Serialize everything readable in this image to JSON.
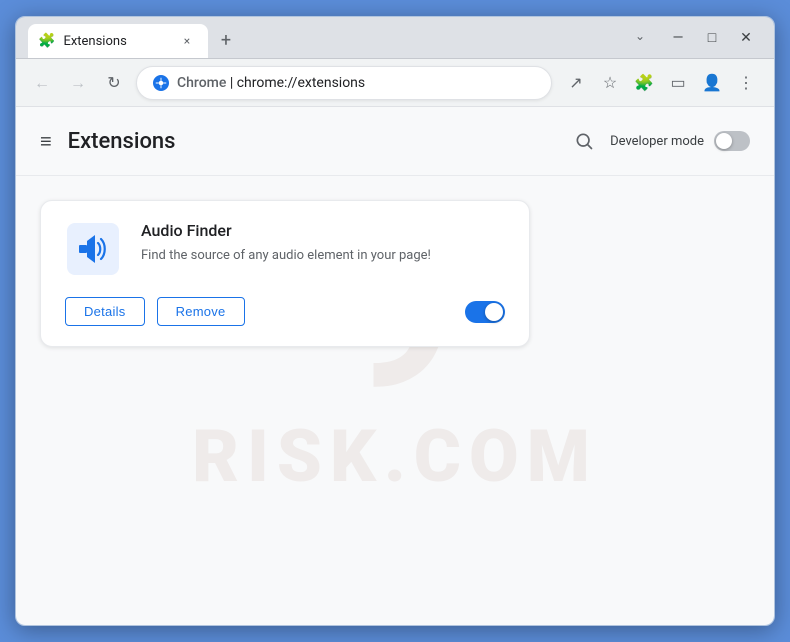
{
  "browser": {
    "tab": {
      "icon": "🧩",
      "title": "Extensions",
      "close_label": "×"
    },
    "new_tab_label": "+",
    "controls": {
      "minimize": "—",
      "maximize": "□",
      "close": "✕",
      "chevron": "⌄"
    },
    "nav": {
      "back": "←",
      "forward": "→",
      "reload": "↻"
    },
    "address": {
      "brand": "Chrome",
      "separator": "|",
      "url": "chrome://extensions"
    },
    "toolbar": {
      "share": "↗",
      "bookmark": "☆",
      "extensions": "🧩",
      "sidebar": "▭",
      "profile": "👤",
      "menu": "⋮"
    }
  },
  "page": {
    "menu_icon": "≡",
    "title": "Extensions",
    "search_tooltip": "Search extensions",
    "dev_mode_label": "Developer mode",
    "dev_mode_on": false
  },
  "extension": {
    "name": "Audio Finder",
    "description": "Find the source of any audio element in your page!",
    "details_label": "Details",
    "remove_label": "Remove",
    "enabled": true
  },
  "watermark": {
    "number": "9",
    "text": "RISK.COM"
  }
}
